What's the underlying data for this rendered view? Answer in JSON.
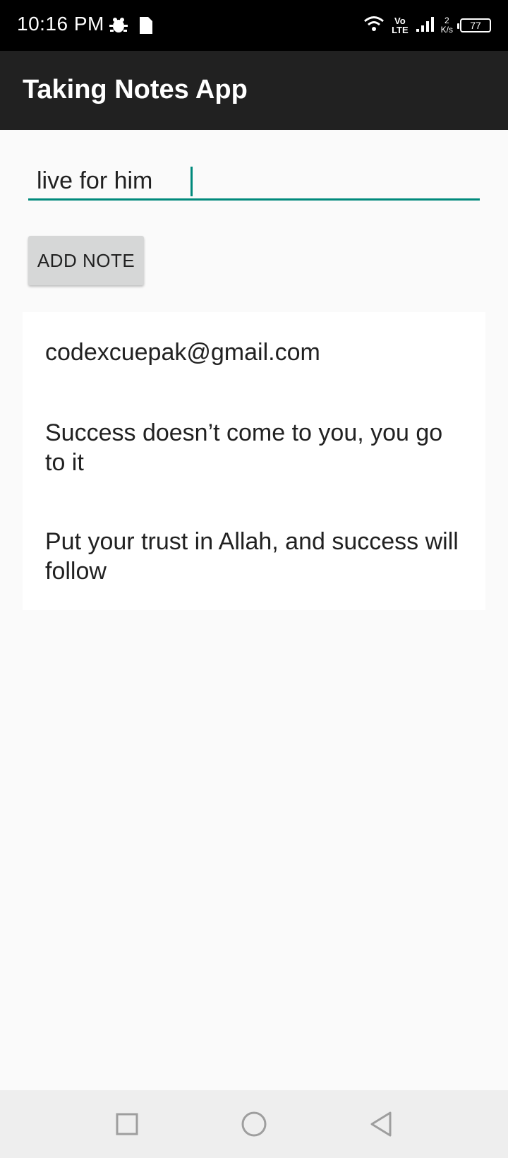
{
  "status_bar": {
    "time": "10:16 PM",
    "volte_top": "Vo",
    "volte_bottom": "LTE",
    "net_speed_value": "2",
    "net_speed_unit": "K/s",
    "battery": "77"
  },
  "app_bar": {
    "title": "Taking Notes App"
  },
  "note_input": {
    "value": "live for him"
  },
  "add_button": {
    "label": "ADD NOTE"
  },
  "notes": [
    "codexcuepak@gmail.com",
    "Success doesn’t come to you, you go to it",
    "Put your trust in Allah, and success will follow"
  ],
  "nav_bar": {
    "recent_icon": "square-icon",
    "home_icon": "circle-icon",
    "back_icon": "triangle-back-icon"
  },
  "colors": {
    "app_bar": "#212121",
    "accent": "#00897b",
    "button": "#d6d7d7",
    "background": "#fafafa"
  }
}
